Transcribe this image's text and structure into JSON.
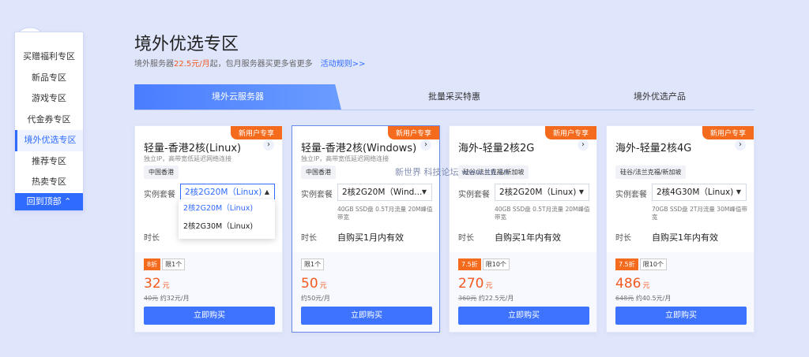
{
  "sidenav": {
    "items": [
      "买赠福利专区",
      "新品专区",
      "游戏专区",
      "代金券专区",
      "境外优选专区",
      "推荐专区",
      "热卖专区"
    ],
    "active_index": 4,
    "back_top": "回到顶部"
  },
  "header": {
    "title": "境外优选专区",
    "sub_pre": "境外服务器",
    "sub_price": "22.5元/月",
    "sub_post": "起，包月服务器买更多省更多",
    "rules_link": "活动规则>>"
  },
  "tabs": [
    "境外云服务器",
    "批量采买特惠",
    "境外优选产品"
  ],
  "labels": {
    "spec": "实例套餐",
    "duration": "时长"
  },
  "cards": [
    {
      "badge": "新用户专享",
      "name": "轻量-香港2核(Linux)",
      "desc": "独立IP，高带宽低延迟网络连接",
      "region": "中国香港",
      "select": "2核2G20M（Linux)",
      "spec": "",
      "duration": "",
      "tags": [
        "8折",
        "限1个"
      ],
      "price": "32",
      "unit": "元",
      "orig_price": "40元",
      "per_month": "约32元/月",
      "buy": "立即购买"
    },
    {
      "badge": "新用户专享",
      "name": "轻量-香港2核(Windows)",
      "desc": "独立IP，高带宽低延迟网络连接",
      "region": "中国香港",
      "select": "2核2G20M（Wind...",
      "spec": "40GB SSD盘 0.5T月流量 20M峰值带宽",
      "duration": "自购买1月内有效",
      "tags": [
        "限1个"
      ],
      "price": "50",
      "unit": "元",
      "orig_price": "",
      "per_month": "约50元/月",
      "buy": "立即购买"
    },
    {
      "badge": "新用户专享",
      "name": "海外-轻量2核2G",
      "desc": "",
      "region": "硅谷/法兰克福/新加坡",
      "select": "2核2G20M（Linux)",
      "spec": "40GB SSD盘 0.5T月流量 20M峰值带宽",
      "duration": "自购买1年内有效",
      "tags": [
        "7.5折",
        "限10个"
      ],
      "price": "270",
      "unit": "元",
      "orig_price": "360元",
      "per_month": "约22.5元/月",
      "buy": "立即购买"
    },
    {
      "badge": "新用户专享",
      "name": "海外-轻量2核4G",
      "desc": "",
      "region": "硅谷/法兰克福/新加坡",
      "select": "2核4G30M（Linux)",
      "spec": "70GB SSD盘 2T月流量 30M峰值带宽",
      "duration": "自购买1年内有效",
      "tags": [
        "7.5折",
        "限10个"
      ],
      "price": "486",
      "unit": "元",
      "orig_price": "648元",
      "per_month": "约40.5元/月",
      "buy": "立即购买"
    }
  ],
  "dropdown": {
    "options": [
      "2核2G20M（Linux)",
      "2核2G30M（Linux)"
    ],
    "selected_index": 0
  },
  "watermark": "新世界 科技论坛 www.lt6.cn",
  "colors": {
    "accent": "#2f6bff",
    "badge": "#f56b1d",
    "price": "#f25a20"
  }
}
